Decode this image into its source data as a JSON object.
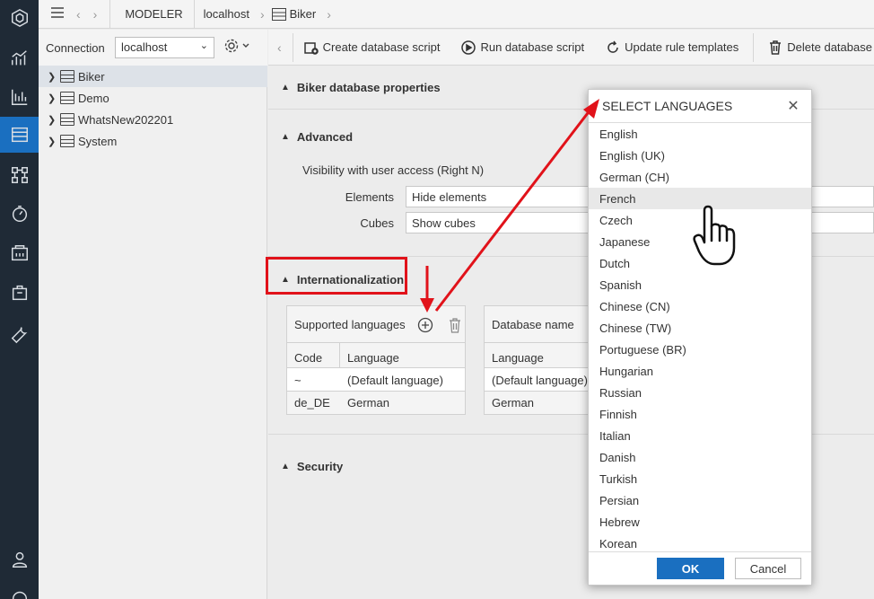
{
  "topbar": {
    "crumbs": [
      "MODELER",
      "localhost",
      "Biker"
    ]
  },
  "connection": {
    "label": "Connection",
    "value": "localhost"
  },
  "tree": {
    "items": [
      {
        "label": "Biker",
        "selected": true
      },
      {
        "label": "Demo",
        "selected": false
      },
      {
        "label": "WhatsNew202201",
        "selected": false
      },
      {
        "label": "System",
        "selected": false
      }
    ]
  },
  "toolbar": {
    "create_script": "Create database script",
    "run_script": "Run database script",
    "update_rules": "Update rule templates",
    "delete_db": "Delete database"
  },
  "main": {
    "properties_header": "Biker database properties",
    "advanced_header": "Advanced",
    "visibility_label": "Visibility with user access (Right N)",
    "elements_label": "Elements",
    "elements_value": "Hide elements",
    "cubes_label": "Cubes",
    "cubes_value": "Show cubes",
    "i18n_header": "Internationalization",
    "supported_languages": "Supported languages",
    "database_name": "Database name",
    "col_code": "Code",
    "col_language": "Language",
    "col_language2": "Language",
    "rows": [
      {
        "code": "~",
        "language": "(Default language)",
        "language2": "(Default language)"
      },
      {
        "code": "de_DE",
        "language": "German",
        "language2": "German"
      }
    ],
    "security_header": "Security"
  },
  "modal": {
    "title": "SELECT LANGUAGES",
    "languages": [
      "English",
      "English (UK)",
      "German (CH)",
      "French",
      "Czech",
      "Japanese",
      "Dutch",
      "Spanish",
      "Chinese (CN)",
      "Chinese (TW)",
      "Portuguese (BR)",
      "Hungarian",
      "Russian",
      "Finnish",
      "Italian",
      "Danish",
      "Turkish",
      "Persian",
      "Hebrew",
      "Korean"
    ],
    "hover_index": 3,
    "ok": "OK",
    "cancel": "Cancel"
  },
  "colors": {
    "rail": "#1f2a36",
    "accent": "#1a6fc0",
    "annotation": "#e1121a"
  }
}
